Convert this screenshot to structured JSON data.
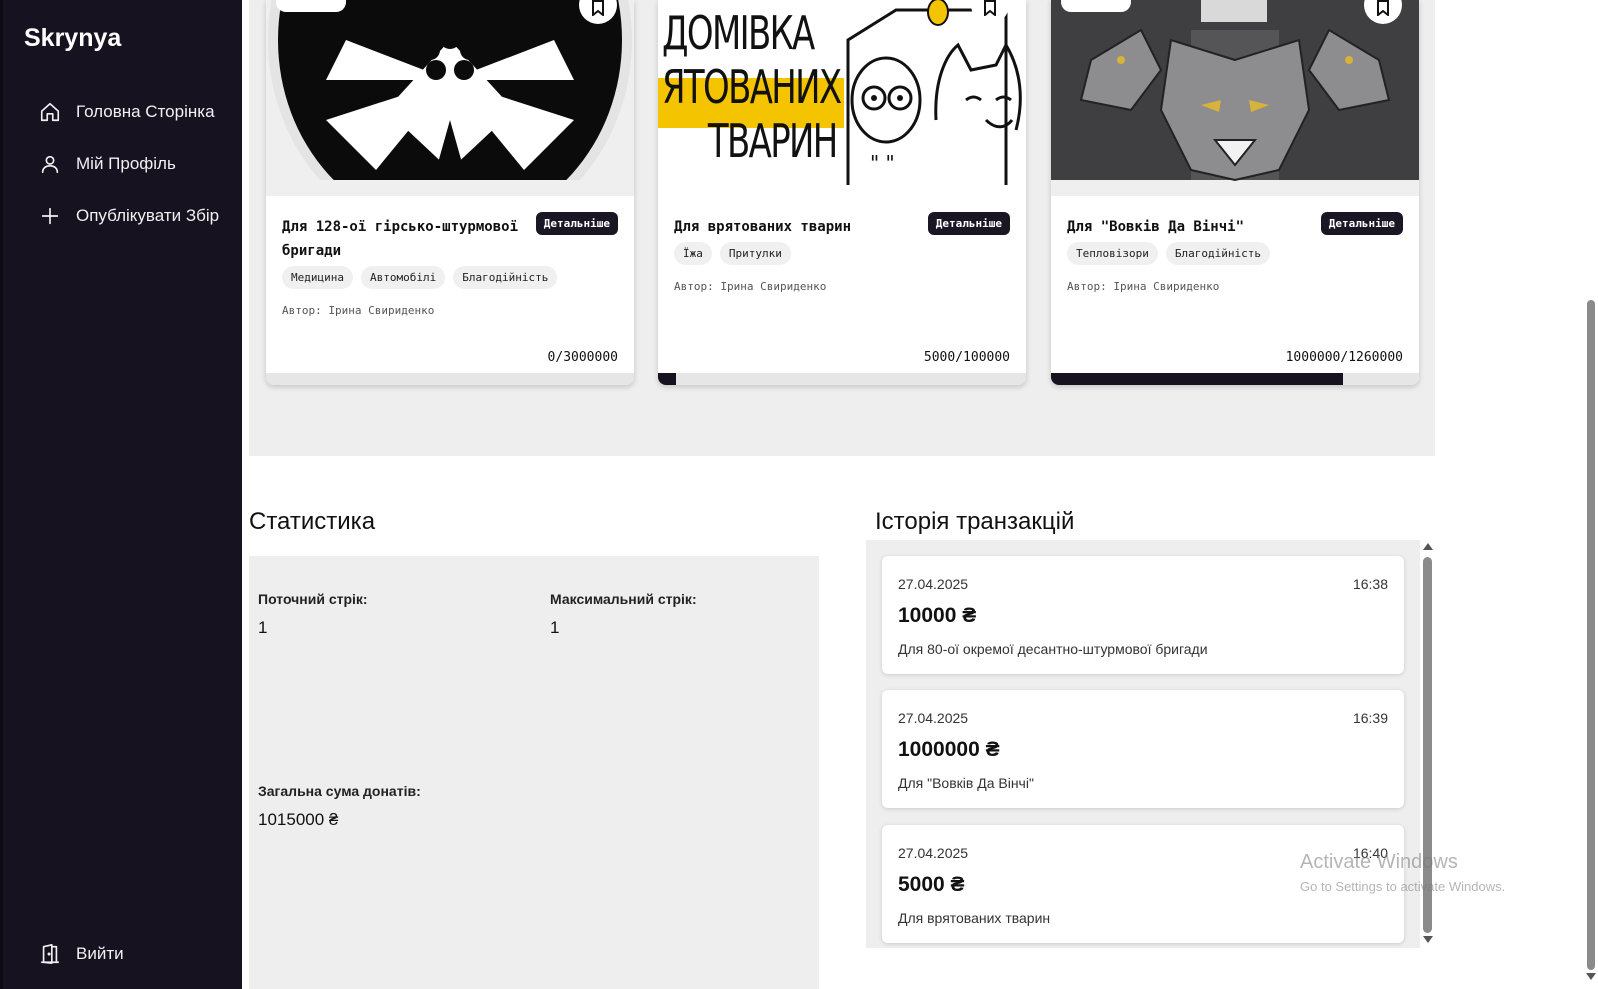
{
  "sidebar": {
    "brand": "Skrynya",
    "items": [
      {
        "label": "Головна Сторінка",
        "icon": "home-icon"
      },
      {
        "label": "Мій Профіль",
        "icon": "user-icon"
      },
      {
        "label": "Опублікувати Збір",
        "icon": "plus-icon"
      }
    ],
    "logout": {
      "label": "Вийти",
      "icon": "door-icon"
    }
  },
  "cards": [
    {
      "title": "Для 128-ої гірсько-штурмової бригади",
      "details_label": "Детальніше",
      "tags": [
        "Медицина",
        "Автомобілі",
        "Благодійність"
      ],
      "author": "Автор: Ірина Свириденко",
      "amount": "0/3000000",
      "progress": 0.0
    },
    {
      "title": "Для врятованих тварин",
      "details_label": "Детальніше",
      "tags": [
        "Їжа",
        "Притулки"
      ],
      "author": "Автор: Ірина Свириденко",
      "amount": "5000/100000",
      "progress": 0.05,
      "image_text": [
        "ДОМІВКА",
        "ЯТОВАНИХ",
        "ТВАРИН"
      ]
    },
    {
      "title": "Для \"Вовків Да Вінчі\"",
      "details_label": "Детальніше",
      "tags": [
        "Тепловізори",
        "Благодійність"
      ],
      "author": "Автор: Ірина Свириденко",
      "amount": "1000000/1260000",
      "progress": 0.794
    }
  ],
  "stats": {
    "title": "Статистика",
    "current_streak_label": "Поточний стрік:",
    "current_streak_value": "1",
    "max_streak_label": "Максимальний стрік:",
    "max_streak_value": "1",
    "total_label": "Загальна сума донатів:",
    "total_value": "1015000 ₴"
  },
  "transactions": {
    "title": "Історія транзакцій",
    "items": [
      {
        "date": "27.04.2025",
        "time": "16:38",
        "amount": "10000 ₴",
        "description": "Для 80-ої окремої десантно-штурмової бригади"
      },
      {
        "date": "27.04.2025",
        "time": "16:39",
        "amount": "1000000 ₴",
        "description": "Для \"Вовків Да Вінчі\""
      },
      {
        "date": "27.04.2025",
        "time": "16:40",
        "amount": "5000 ₴",
        "description": "Для врятованих тварин"
      }
    ]
  },
  "watermark": {
    "line1": "Activate Windows",
    "line2": "Go to Settings to activate Windows."
  },
  "colors": {
    "sidebar_bg": "#16121f",
    "panel_bg": "#eeeeee",
    "accent_yellow": "#f5c400"
  }
}
